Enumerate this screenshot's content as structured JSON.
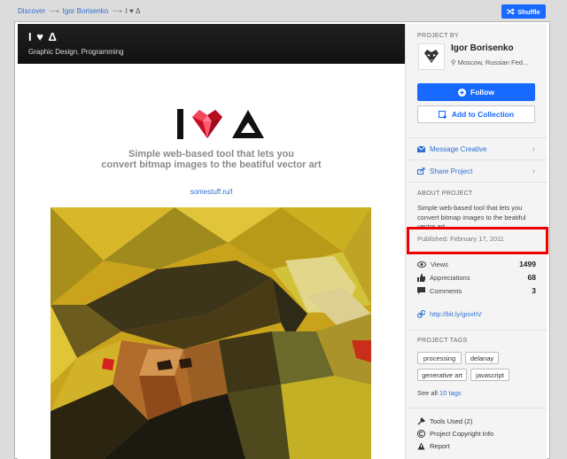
{
  "breadcrumb": {
    "items": [
      "Discover",
      "Igor Borisenko"
    ],
    "current": "I ♥ Δ",
    "separator": "⟶"
  },
  "topbar": {
    "shuffle_label": "Shuffle"
  },
  "project": {
    "title": "I ♥ Δ",
    "fields": "Graphic Design, Programming",
    "tagline_line1": "Simple web-based tool that lets you",
    "tagline_line2": "convert bitmap images to the beatiful vector art",
    "link": "somestuff.ru/l"
  },
  "sidebar": {
    "project_by_label": "PROJECT BY",
    "owner_name": "Igor Borisenko",
    "owner_location": "Moscow, Russian Fed...",
    "follow_label": "Follow",
    "add_collection_label": "Add to Collection",
    "message_label": "Message Creative",
    "share_label": "Share Project",
    "about_label": "ABOUT PROJECT",
    "about_text": "Simple web-based tool that lets you convert bitmap images to the beatiful vector art",
    "published": "Published: February 17, 2011",
    "stats": [
      {
        "label": "Views",
        "value": "1499",
        "icon": "eye-icon"
      },
      {
        "label": "Appreciations",
        "value": "68",
        "icon": "thumbs-up-icon"
      },
      {
        "label": "Comments",
        "value": "3",
        "icon": "comment-icon"
      }
    ],
    "short_link": "http://bit.ly/gisxhV",
    "tags_label": "PROJECT TAGS",
    "tags": [
      "processing",
      "delanay",
      "generative art",
      "javascript"
    ],
    "see_all_prefix": "See all ",
    "see_all_link": "10 tags",
    "tools_label": "Tools Used (2)",
    "copyright_label": "Project Copyright Info",
    "report_label": "Report"
  },
  "colors": {
    "accent": "#1769ff",
    "highlight": "#ee0000",
    "heart": "#e0132f"
  }
}
